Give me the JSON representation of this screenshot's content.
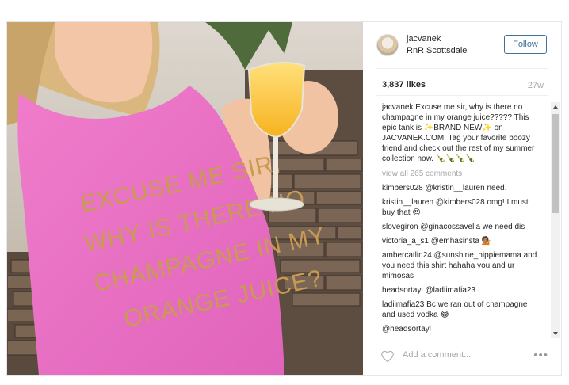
{
  "post": {
    "image_alt": "Woman in pink tank holding mimosa",
    "shirt_lines": [
      "EXCUSE ME SIR,",
      "WHY IS THERE NO",
      "CHAMPAGNE IN MY",
      "ORANGE JUICE?"
    ]
  },
  "header": {
    "username": "jacvanek",
    "location": "RnR Scottsdale",
    "follow_label": "Follow"
  },
  "stats": {
    "likes": "3,837 likes",
    "age": "27w"
  },
  "caption": {
    "user": "jacvanek",
    "text": "Excuse me sir, why is there no champagne in my orange juice????? This epic tank is ✨BRAND NEW✨ on JACVANEK.COM! Tag your favorite boozy friend and check out the rest of my summer collection now. 🍾🍾🍾🍾"
  },
  "view_all": "view all 265 comments",
  "comments": [
    {
      "user": "kimbers028",
      "text": "@kristin__lauren need."
    },
    {
      "user": "kristin__lauren",
      "text": "@kimbers028 omg! I must buy that 😍"
    },
    {
      "user": "slovegiron",
      "text": "@ginacossavella we need dis"
    },
    {
      "user": "victoria_a_s1",
      "text": "@emhasinsta 💁🏽"
    },
    {
      "user": "ambercatlin24",
      "text": "@sunshine_hippiemama and you need this shirt hahaha you and ur mimosas"
    },
    {
      "user": "headsortayl",
      "text": "@ladiimafia23"
    },
    {
      "user": "ladiimafia23",
      "text": "Bc we ran out of champagne and used vodka 😂"
    },
    {
      "user": "",
      "text": "@headsortayl"
    }
  ],
  "footer": {
    "add_comment": "Add a comment...",
    "more": "•••"
  },
  "icons": {
    "heart": "heart-icon",
    "more": "more-options-icon"
  },
  "colors": {
    "follow_blue": "#3f729b",
    "muted": "#a5a7aa",
    "shirt_pink": "#e873c4"
  }
}
